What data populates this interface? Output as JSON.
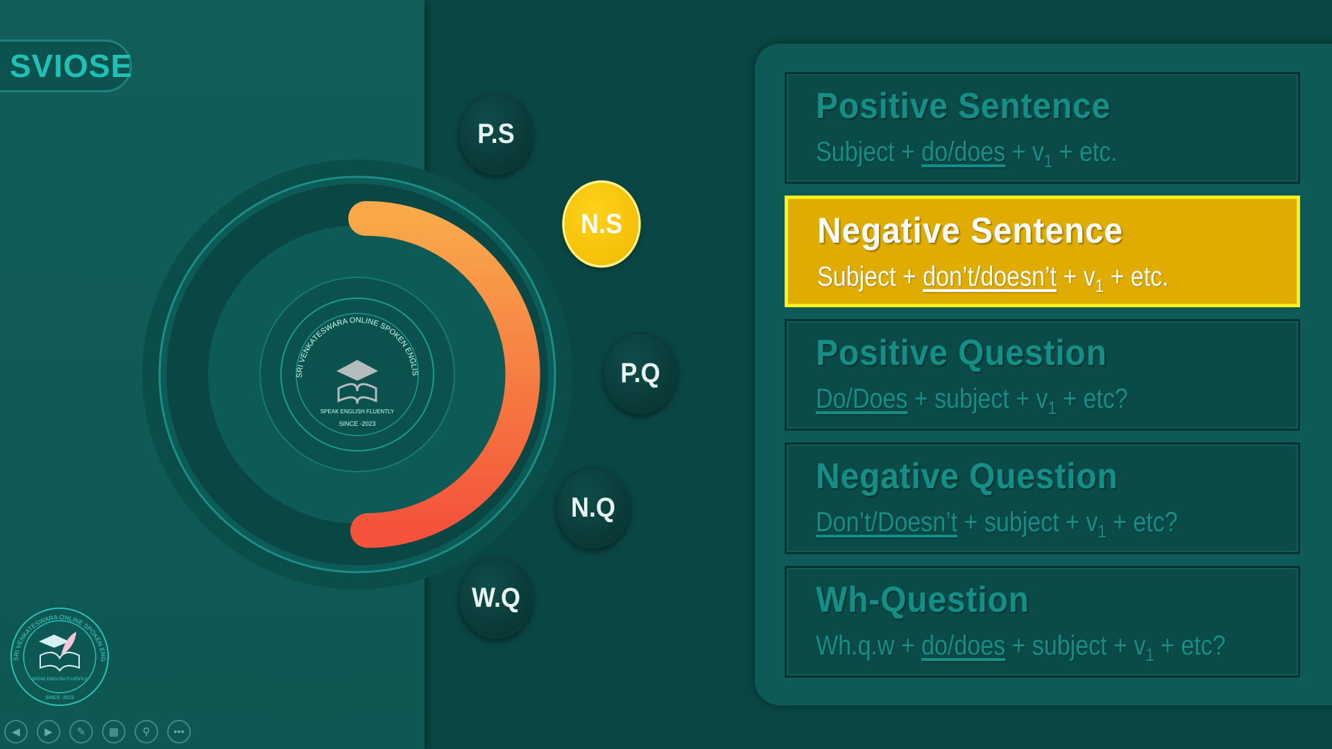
{
  "brand": "SVIOSE",
  "logo": {
    "ring_text": "SRI VENKATESWARA ONLINE SPOKEN ENGLISH SCHOOL",
    "tagline": "SPEAK ENGLISH FLUENTLY",
    "since": "SINCE -2023"
  },
  "nodes": [
    {
      "label": "P.S",
      "active": false
    },
    {
      "label": "N.S",
      "active": true
    },
    {
      "label": "P.Q",
      "active": false
    },
    {
      "label": "N.Q",
      "active": false
    },
    {
      "label": "W.Q",
      "active": false
    }
  ],
  "cards": [
    {
      "title": "Positive Sentence",
      "pre": "Subject + ",
      "u": "do/does",
      "mid": " + v",
      "sub": "1",
      "post": " + etc."
    },
    {
      "title": "Negative Sentence",
      "pre": "Subject + ",
      "u": "don’t/doesn’t",
      "mid": " + v",
      "sub": "1",
      "post": " + etc."
    },
    {
      "title": "Positive Question",
      "pre": "",
      "u": "Do/Does",
      "mid": " + subject + v",
      "sub": "1",
      "post": " + etc?"
    },
    {
      "title": "Negative Question",
      "pre": "",
      "u": "Don’t/Doesn’t",
      "mid": " + subject + v",
      "sub": "1",
      "post": " + etc?"
    },
    {
      "title": "Wh-Question",
      "pre": "Wh.q.w + ",
      "u": "do/does",
      "mid": " + subject + v",
      "sub": "1",
      "post": " + etc?"
    }
  ],
  "toolbar": [
    "previous-icon",
    "next-icon",
    "pen-icon",
    "slides-icon",
    "zoom-icon",
    "more-icon"
  ],
  "colors": {
    "accent": "#e0ac00",
    "teal": "#148f86",
    "arc_start": "#f9a94a",
    "arc_end": "#f4523a"
  }
}
